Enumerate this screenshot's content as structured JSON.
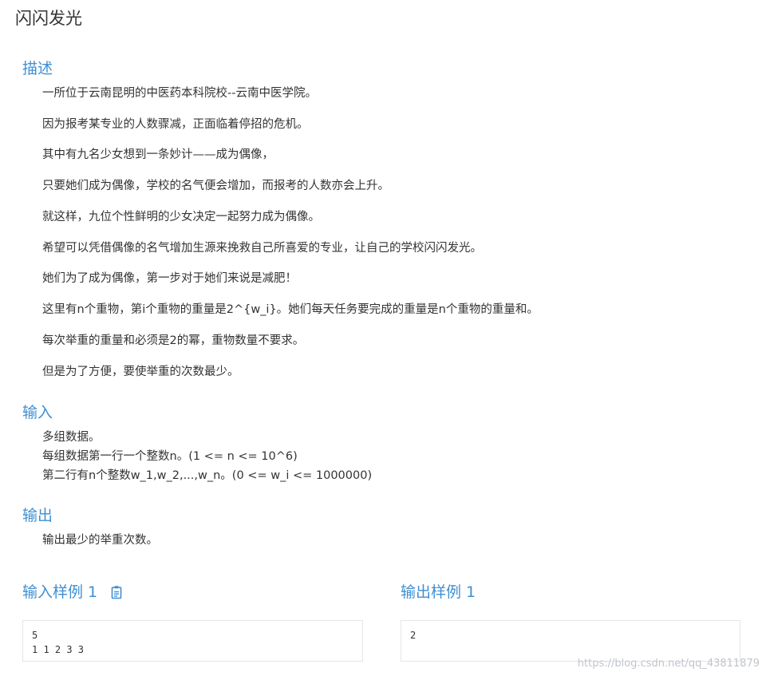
{
  "problem": {
    "title": "闪闪发光"
  },
  "description": {
    "heading": "描述",
    "paragraphs": [
      "一所位于云南昆明的中医药本科院校--云南中医学院。",
      "因为报考某专业的人数骤减，正面临着停招的危机。",
      "其中有九名少女想到一条妙计——成为偶像，",
      "只要她们成为偶像，学校的名气便会增加，而报考的人数亦会上升。",
      "就这样，九位个性鲜明的少女决定一起努力成为偶像。",
      "希望可以凭借偶像的名气增加生源来挽救自己所喜爱的专业，让自己的学校闪闪发光。",
      "她们为了成为偶像，第一步对于她们来说是减肥！",
      "这里有n个重物，第i个重物的重量是2^{w_i}。她们每天任务要完成的重量是n个重物的重量和。",
      "每次举重的重量和必须是2的幂，重物数量不要求。",
      "但是为了方便，要使举重的次数最少。"
    ]
  },
  "input": {
    "heading": "输入",
    "lines": [
      "多组数据。",
      "每组数据第一行一个整数n。(1 <= n <= 10^6)",
      "第二行有n个整数w_1,w_2,...,w_n。(0 <= w_i <= 1000000)"
    ]
  },
  "output": {
    "heading": "输出",
    "lines": [
      "输出最少的举重次数。"
    ]
  },
  "samples": {
    "input_heading": "输入样例 1",
    "copy_icon": "clipboard-icon",
    "input_content": "5\n1 1 2 3 3",
    "output_heading": "输出样例 1",
    "output_content": "2"
  },
  "watermark": "https://blog.csdn.net/qq_43811879",
  "colors": {
    "heading": "#3f8fd2",
    "text": "#333333",
    "border": "#e5e5e5"
  }
}
